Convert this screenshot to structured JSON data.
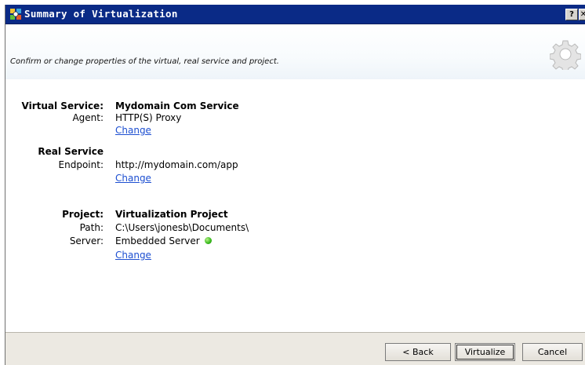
{
  "window": {
    "title": "Summary of Virtualization",
    "help_label": "?",
    "close_label": "✕"
  },
  "header": {
    "subtitle": "Confirm or change properties of the virtual, real service and project."
  },
  "virtual_service": {
    "label": "Virtual Service:",
    "value": "Mydomain Com Service",
    "agent_label": "Agent:",
    "agent_value": "HTTP(S) Proxy",
    "change_label": "Change"
  },
  "real_service": {
    "label": "Real Service",
    "endpoint_label": "Endpoint:",
    "endpoint_value": "http://mydomain.com/app",
    "change_label": "Change"
  },
  "project": {
    "label": "Project:",
    "value": "Virtualization Project",
    "path_label": "Path:",
    "path_value": "C:\\Users\\jonesb\\Documents\\",
    "server_label": "Server:",
    "server_value": "Embedded Server",
    "server_status_color": "#35b81a",
    "change_label": "Change"
  },
  "footer": {
    "back_label": "< Back",
    "virtualize_label": "Virtualize",
    "cancel_label": "Cancel"
  },
  "icons": {
    "app": "virtualization-app-icon",
    "header": "gear-icon"
  }
}
